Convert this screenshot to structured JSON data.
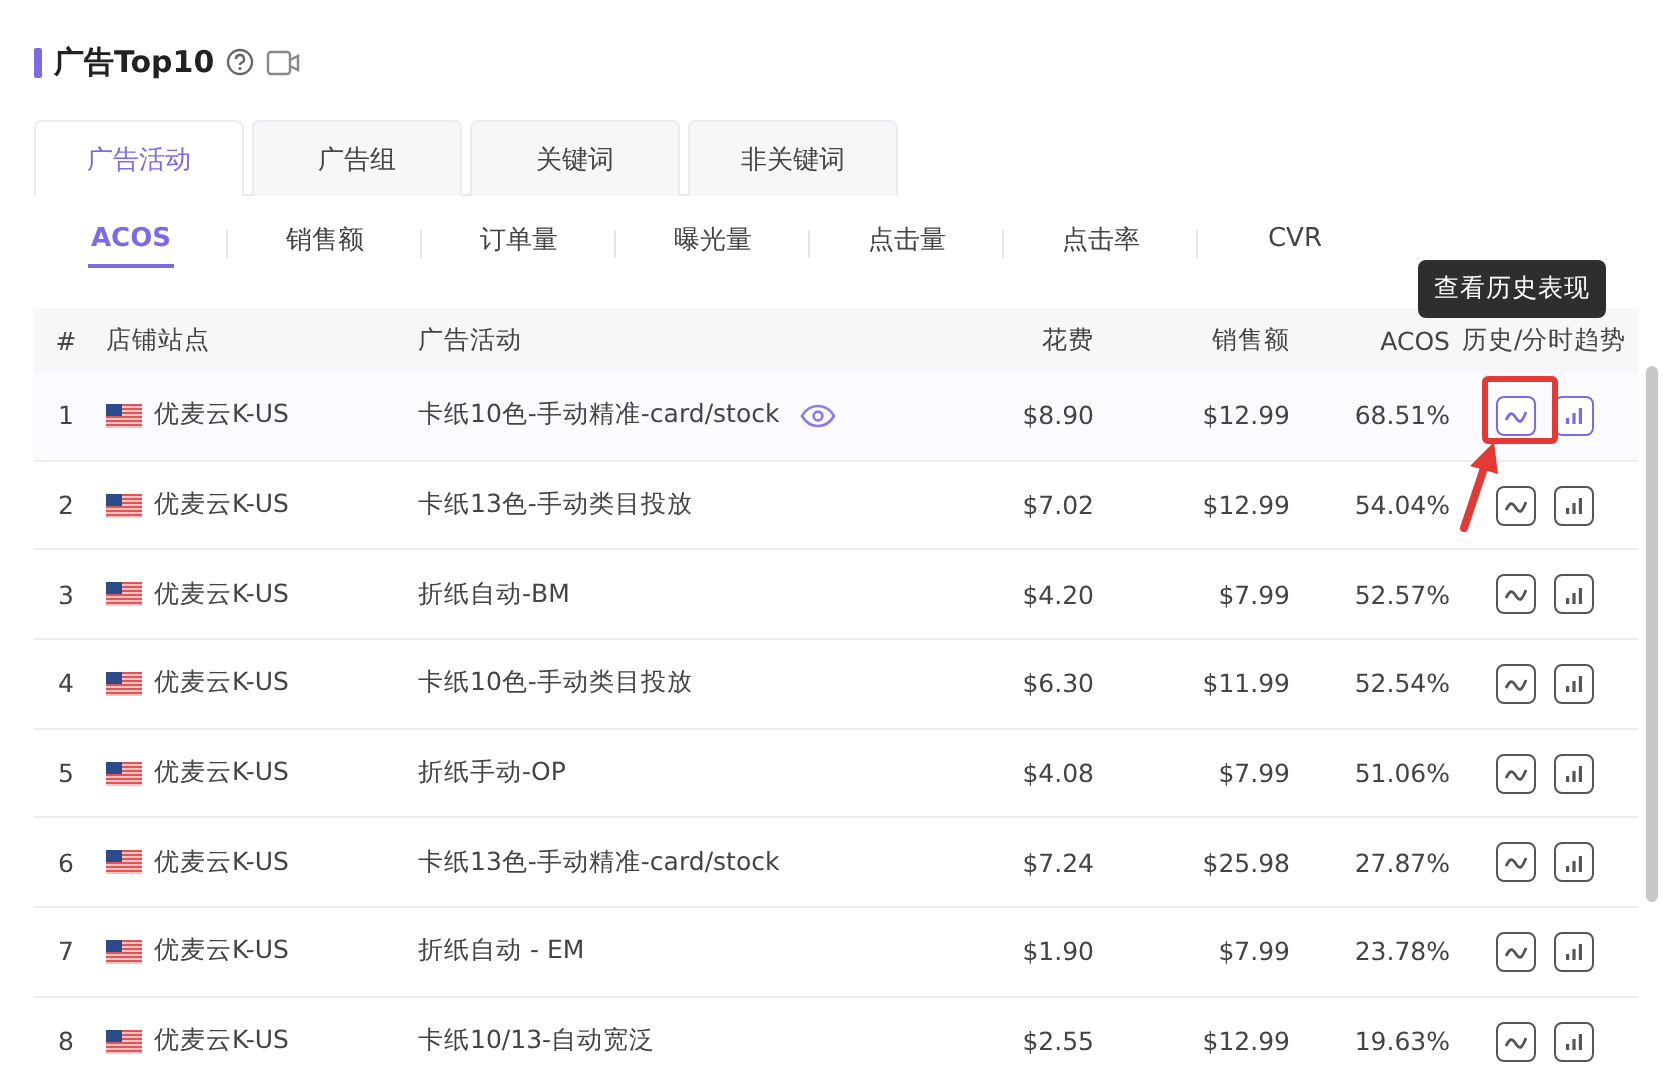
{
  "title": "广告Top10",
  "tabs": [
    {
      "label": "广告活动",
      "selected": true
    },
    {
      "label": "广告组",
      "selected": false
    },
    {
      "label": "关键词",
      "selected": false
    },
    {
      "label": "非关键词",
      "selected": false
    }
  ],
  "metrics": [
    {
      "label": "ACOS",
      "selected": true
    },
    {
      "label": "销售额",
      "selected": false
    },
    {
      "label": "订单量",
      "selected": false
    },
    {
      "label": "曝光量",
      "selected": false
    },
    {
      "label": "点击量",
      "selected": false
    },
    {
      "label": "点击率",
      "selected": false
    },
    {
      "label": "CVR",
      "selected": false
    }
  ],
  "columns": [
    "#",
    "店铺站点",
    "广告活动",
    "花费",
    "销售额",
    "ACOS",
    "历史/分时趋势"
  ],
  "tooltip": "查看历史表现",
  "rows": [
    {
      "index": "1",
      "store": "优麦云K-US",
      "campaign": "卡纸10色-手动精准-card/stock",
      "spend": "$8.90",
      "sales": "$12.99",
      "acos": "68.51%",
      "highlighted": true,
      "watched": true
    },
    {
      "index": "2",
      "store": "优麦云K-US",
      "campaign": "卡纸13色-手动类目投放",
      "spend": "$7.02",
      "sales": "$12.99",
      "acos": "54.04%",
      "highlighted": false,
      "watched": false
    },
    {
      "index": "3",
      "store": "优麦云K-US",
      "campaign": "折纸自动-BM",
      "spend": "$4.20",
      "sales": "$7.99",
      "acos": "52.57%",
      "highlighted": false,
      "watched": false
    },
    {
      "index": "4",
      "store": "优麦云K-US",
      "campaign": "卡纸10色-手动类目投放",
      "spend": "$6.30",
      "sales": "$11.99",
      "acos": "52.54%",
      "highlighted": false,
      "watched": false
    },
    {
      "index": "5",
      "store": "优麦云K-US",
      "campaign": "折纸手动-OP",
      "spend": "$4.08",
      "sales": "$7.99",
      "acos": "51.06%",
      "highlighted": false,
      "watched": false
    },
    {
      "index": "6",
      "store": "优麦云K-US",
      "campaign": "卡纸13色-手动精准-card/stock",
      "spend": "$7.24",
      "sales": "$25.98",
      "acos": "27.87%",
      "highlighted": false,
      "watched": false
    },
    {
      "index": "7",
      "store": "优麦云K-US",
      "campaign": "折纸自动 - EM",
      "spend": "$1.90",
      "sales": "$7.99",
      "acos": "23.78%",
      "highlighted": false,
      "watched": false
    },
    {
      "index": "8",
      "store": "优麦云K-US",
      "campaign": "卡纸10/13-自动宽泛",
      "spend": "$2.55",
      "sales": "$12.99",
      "acos": "19.63%",
      "highlighted": false,
      "watched": false
    }
  ]
}
